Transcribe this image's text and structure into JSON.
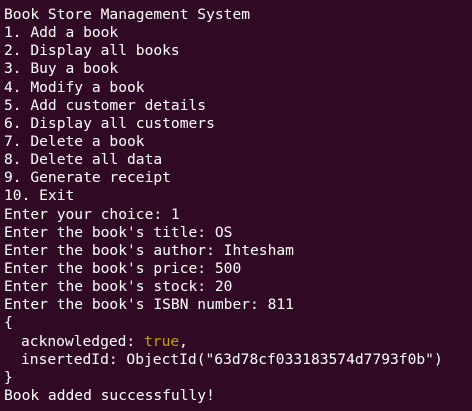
{
  "terminal": {
    "title_line": "Book Store Management System",
    "menu": [
      "1. Add a book",
      "2. Display all books",
      "3. Buy a book",
      "4. Modify a book",
      "5. Add customer details",
      "6. Display all customers",
      "7. Delete a book",
      "8. Delete all data",
      "9. Generate receipt",
      "10. Exit"
    ],
    "prompts": [
      "Enter your choice: 1",
      "Enter the book's title: OS",
      "Enter the book's author: Ihtesham",
      "Enter the book's price: 500",
      "Enter the book's stock: 20",
      "Enter the book's ISBN number: 811"
    ],
    "result": {
      "open_brace": "{",
      "acknowledged_key": "acknowledged: ",
      "acknowledged_value": "true",
      "acknowledged_suffix": ",",
      "inserted_id_line": "insertedId: ObjectId(\"63d78cf033183574d7793f0b\")",
      "close_brace": "}"
    },
    "success_message": "Book added successfully!",
    "colors": {
      "background": "#300a24",
      "text": "#ffffff",
      "boolean": "#c4a000"
    }
  }
}
